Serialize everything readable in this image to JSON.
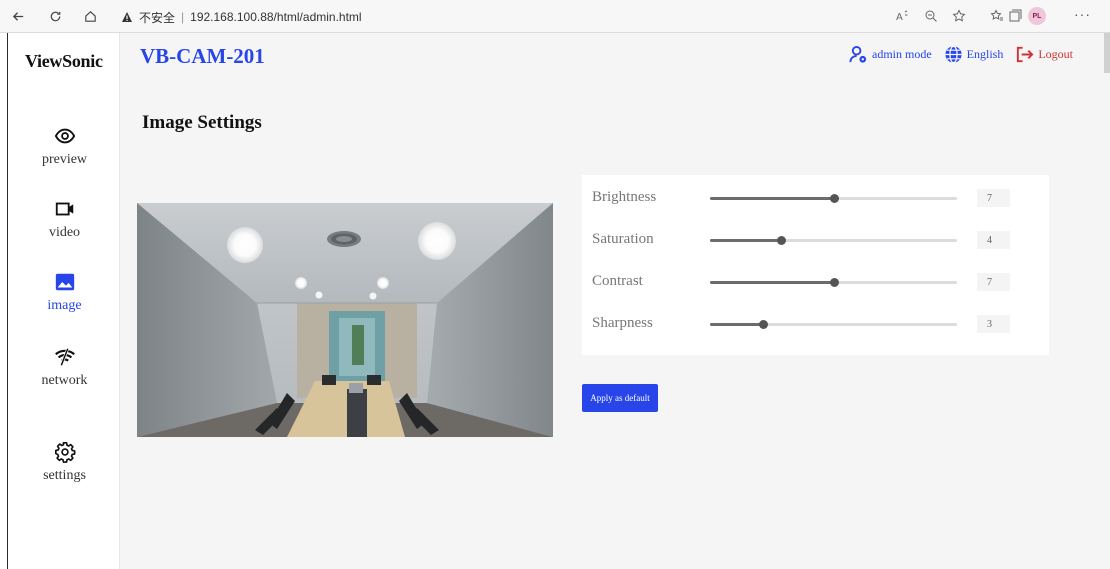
{
  "browser": {
    "insecure_label": "不安全",
    "separator": "|",
    "url": "192.168.100.88/html/admin.html",
    "profile_initials": "PL",
    "more": "···"
  },
  "sidebar": {
    "logo": "ViewSonic",
    "items": [
      {
        "label": "preview",
        "icon": "eye-icon"
      },
      {
        "label": "video",
        "icon": "video-camera-icon"
      },
      {
        "label": "image",
        "icon": "image-icon",
        "active": true
      },
      {
        "label": "network",
        "icon": "wifi-off-icon"
      },
      {
        "label": "settings",
        "icon": "gear-icon"
      }
    ]
  },
  "header": {
    "camera_name": "VB-CAM-201",
    "admin_mode": "admin mode",
    "language": "English",
    "logout": "Logout"
  },
  "page": {
    "title": "Image Settings"
  },
  "settings": {
    "max": 14,
    "sliders": [
      {
        "name": "Brightness",
        "value": "7"
      },
      {
        "name": "Saturation",
        "value": "4"
      },
      {
        "name": "Contrast",
        "value": "7"
      },
      {
        "name": "Sharpness",
        "value": "3"
      }
    ],
    "apply_label": "Apply as default"
  },
  "colors": {
    "accent": "#2745e8",
    "logout": "#d33131",
    "background": "#f5f5f5"
  }
}
